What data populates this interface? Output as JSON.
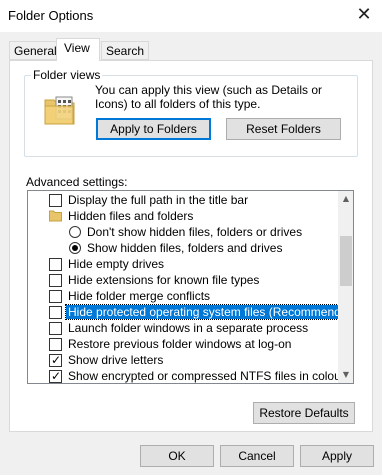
{
  "window": {
    "title": "Folder Options",
    "close_glyph": "✕"
  },
  "tabs": [
    {
      "label": "General",
      "active": false
    },
    {
      "label": "View",
      "active": true
    },
    {
      "label": "Search",
      "active": false
    }
  ],
  "folder_views": {
    "label": "Folder views",
    "description": "You can apply this view (such as Details or Icons) to all folders of this type.",
    "icon": "folder-views-icon",
    "apply_button": "Apply to Folders",
    "reset_button": "Reset Folders"
  },
  "advanced": {
    "label": "Advanced settings:",
    "items": [
      {
        "kind": "checkbox",
        "checked": false,
        "label": "Display the full path in the title bar"
      },
      {
        "kind": "folder",
        "label": "Hidden files and folders"
      },
      {
        "kind": "radio",
        "checked": false,
        "label": "Don't show hidden files, folders or drives"
      },
      {
        "kind": "radio",
        "checked": true,
        "label": "Show hidden files, folders and drives"
      },
      {
        "kind": "checkbox",
        "checked": false,
        "label": "Hide empty drives"
      },
      {
        "kind": "checkbox",
        "checked": false,
        "label": "Hide extensions for known file types"
      },
      {
        "kind": "checkbox",
        "checked": false,
        "label": "Hide folder merge conflicts"
      },
      {
        "kind": "checkbox",
        "checked": false,
        "label": "Hide protected operating system files (Recommended)",
        "selected": true
      },
      {
        "kind": "checkbox",
        "checked": false,
        "label": "Launch folder windows in a separate process"
      },
      {
        "kind": "checkbox",
        "checked": false,
        "label": "Restore previous folder windows at log-on"
      },
      {
        "kind": "checkbox",
        "checked": true,
        "label": "Show drive letters"
      },
      {
        "kind": "checkbox",
        "checked": true,
        "label": "Show encrypted or compressed NTFS files in colour"
      }
    ],
    "restore_button": "Restore Defaults"
  },
  "footer": {
    "ok": "OK",
    "cancel": "Cancel",
    "apply": "Apply"
  },
  "colors": {
    "accent": "#0078d7",
    "selection": "#0078d7",
    "folder": "#e8c46a"
  }
}
